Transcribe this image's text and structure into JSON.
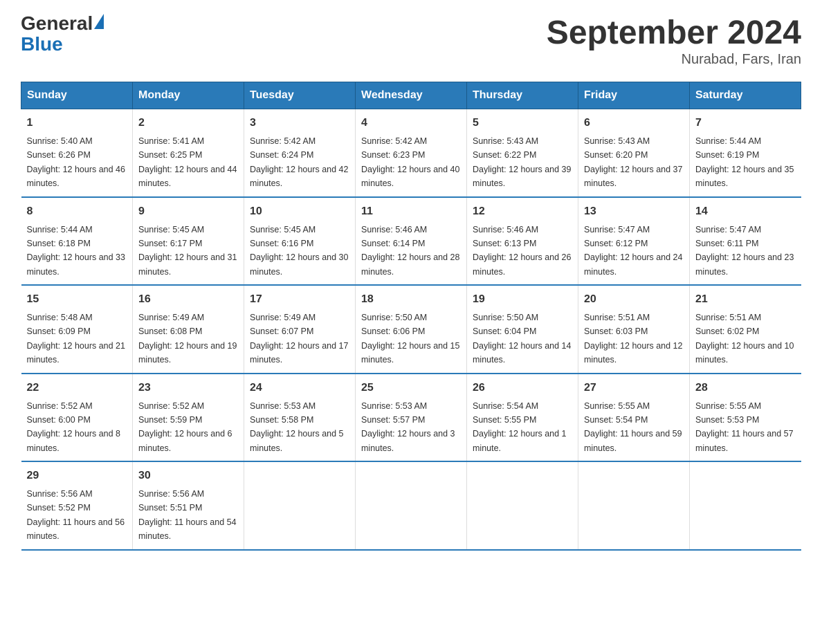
{
  "logo": {
    "general": "General",
    "blue": "Blue"
  },
  "title": "September 2024",
  "subtitle": "Nurabad, Fars, Iran",
  "header_days": [
    "Sunday",
    "Monday",
    "Tuesday",
    "Wednesday",
    "Thursday",
    "Friday",
    "Saturday"
  ],
  "weeks": [
    [
      {
        "day": "1",
        "sunrise": "5:40 AM",
        "sunset": "6:26 PM",
        "daylight": "12 hours and 46 minutes."
      },
      {
        "day": "2",
        "sunrise": "5:41 AM",
        "sunset": "6:25 PM",
        "daylight": "12 hours and 44 minutes."
      },
      {
        "day": "3",
        "sunrise": "5:42 AM",
        "sunset": "6:24 PM",
        "daylight": "12 hours and 42 minutes."
      },
      {
        "day": "4",
        "sunrise": "5:42 AM",
        "sunset": "6:23 PM",
        "daylight": "12 hours and 40 minutes."
      },
      {
        "day": "5",
        "sunrise": "5:43 AM",
        "sunset": "6:22 PM",
        "daylight": "12 hours and 39 minutes."
      },
      {
        "day": "6",
        "sunrise": "5:43 AM",
        "sunset": "6:20 PM",
        "daylight": "12 hours and 37 minutes."
      },
      {
        "day": "7",
        "sunrise": "5:44 AM",
        "sunset": "6:19 PM",
        "daylight": "12 hours and 35 minutes."
      }
    ],
    [
      {
        "day": "8",
        "sunrise": "5:44 AM",
        "sunset": "6:18 PM",
        "daylight": "12 hours and 33 minutes."
      },
      {
        "day": "9",
        "sunrise": "5:45 AM",
        "sunset": "6:17 PM",
        "daylight": "12 hours and 31 minutes."
      },
      {
        "day": "10",
        "sunrise": "5:45 AM",
        "sunset": "6:16 PM",
        "daylight": "12 hours and 30 minutes."
      },
      {
        "day": "11",
        "sunrise": "5:46 AM",
        "sunset": "6:14 PM",
        "daylight": "12 hours and 28 minutes."
      },
      {
        "day": "12",
        "sunrise": "5:46 AM",
        "sunset": "6:13 PM",
        "daylight": "12 hours and 26 minutes."
      },
      {
        "day": "13",
        "sunrise": "5:47 AM",
        "sunset": "6:12 PM",
        "daylight": "12 hours and 24 minutes."
      },
      {
        "day": "14",
        "sunrise": "5:47 AM",
        "sunset": "6:11 PM",
        "daylight": "12 hours and 23 minutes."
      }
    ],
    [
      {
        "day": "15",
        "sunrise": "5:48 AM",
        "sunset": "6:09 PM",
        "daylight": "12 hours and 21 minutes."
      },
      {
        "day": "16",
        "sunrise": "5:49 AM",
        "sunset": "6:08 PM",
        "daylight": "12 hours and 19 minutes."
      },
      {
        "day": "17",
        "sunrise": "5:49 AM",
        "sunset": "6:07 PM",
        "daylight": "12 hours and 17 minutes."
      },
      {
        "day": "18",
        "sunrise": "5:50 AM",
        "sunset": "6:06 PM",
        "daylight": "12 hours and 15 minutes."
      },
      {
        "day": "19",
        "sunrise": "5:50 AM",
        "sunset": "6:04 PM",
        "daylight": "12 hours and 14 minutes."
      },
      {
        "day": "20",
        "sunrise": "5:51 AM",
        "sunset": "6:03 PM",
        "daylight": "12 hours and 12 minutes."
      },
      {
        "day": "21",
        "sunrise": "5:51 AM",
        "sunset": "6:02 PM",
        "daylight": "12 hours and 10 minutes."
      }
    ],
    [
      {
        "day": "22",
        "sunrise": "5:52 AM",
        "sunset": "6:00 PM",
        "daylight": "12 hours and 8 minutes."
      },
      {
        "day": "23",
        "sunrise": "5:52 AM",
        "sunset": "5:59 PM",
        "daylight": "12 hours and 6 minutes."
      },
      {
        "day": "24",
        "sunrise": "5:53 AM",
        "sunset": "5:58 PM",
        "daylight": "12 hours and 5 minutes."
      },
      {
        "day": "25",
        "sunrise": "5:53 AM",
        "sunset": "5:57 PM",
        "daylight": "12 hours and 3 minutes."
      },
      {
        "day": "26",
        "sunrise": "5:54 AM",
        "sunset": "5:55 PM",
        "daylight": "12 hours and 1 minute."
      },
      {
        "day": "27",
        "sunrise": "5:55 AM",
        "sunset": "5:54 PM",
        "daylight": "11 hours and 59 minutes."
      },
      {
        "day": "28",
        "sunrise": "5:55 AM",
        "sunset": "5:53 PM",
        "daylight": "11 hours and 57 minutes."
      }
    ],
    [
      {
        "day": "29",
        "sunrise": "5:56 AM",
        "sunset": "5:52 PM",
        "daylight": "11 hours and 56 minutes."
      },
      {
        "day": "30",
        "sunrise": "5:56 AM",
        "sunset": "5:51 PM",
        "daylight": "11 hours and 54 minutes."
      },
      null,
      null,
      null,
      null,
      null
    ]
  ],
  "labels": {
    "sunrise_prefix": "Sunrise: ",
    "sunset_prefix": "Sunset: ",
    "daylight_prefix": "Daylight: "
  }
}
